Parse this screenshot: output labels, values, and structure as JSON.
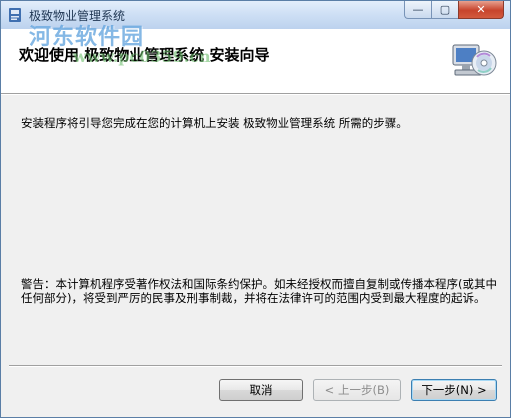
{
  "window": {
    "title": "极致物业管理系统",
    "controls": {
      "minimize": "—",
      "maximize": "▢",
      "close": "✕"
    }
  },
  "watermark": {
    "text": "河东软件园",
    "url": "www.pc0359.cn"
  },
  "header": {
    "title": "欢迎使用 极致物业管理系统 安装向导",
    "art_icon": "computer-cd-icon"
  },
  "body": {
    "intro": "安装程序将引导您完成在您的计算机上安装 极致物业管理系统 所需的步骤。",
    "warning": "警告：本计算机程序受著作权法和国际条约保护。如未经授权而擅自复制或传播本程序(或其中任何部分)，将受到严厉的民事及刑事制裁，并将在法律许可的范围内受到最大程度的起诉。"
  },
  "buttons": {
    "cancel": "取消",
    "back": "< 上一步(B)",
    "next": "下一步(N) >"
  },
  "colors": {
    "titlebar": "#cfe0f5",
    "close": "#c7442c",
    "dialog_bg": "#f0f0f0",
    "default_button_border": "#3c7fb1"
  }
}
